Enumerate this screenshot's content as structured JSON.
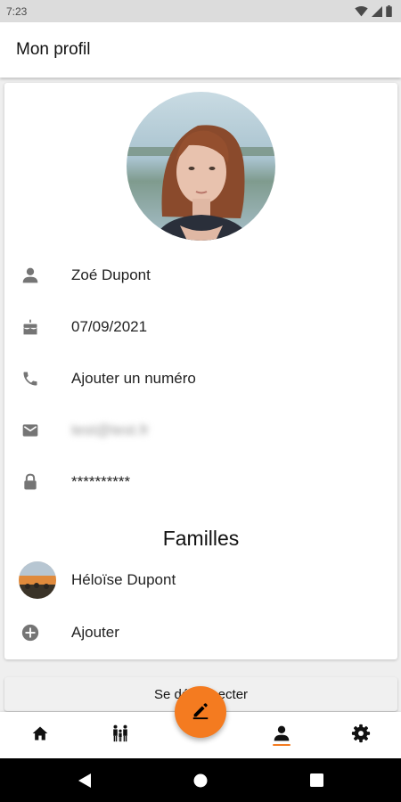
{
  "status_bar": {
    "time": "7:23",
    "icons": [
      "wifi-icon",
      "signal-icon",
      "battery-icon"
    ]
  },
  "app_bar": {
    "title": "Mon profil"
  },
  "profile": {
    "name": "Zoé Dupont",
    "birthdate": "07/09/2021",
    "phone_placeholder": "Ajouter un numéro",
    "email": "test@test.fr",
    "password": "**********"
  },
  "families": {
    "title": "Familles",
    "items": [
      {
        "name": "Héloïse Dupont"
      }
    ],
    "add_label": "Ajouter"
  },
  "logout_label": "Se déconnecter",
  "bottom_nav": {
    "items": [
      "home-icon",
      "family-icon",
      "profile-icon",
      "settings-icon"
    ],
    "active": "profile-icon"
  },
  "fab": {
    "icon": "edit-icon"
  },
  "colors": {
    "accent": "#f47b20",
    "icon_gray": "#757575"
  }
}
